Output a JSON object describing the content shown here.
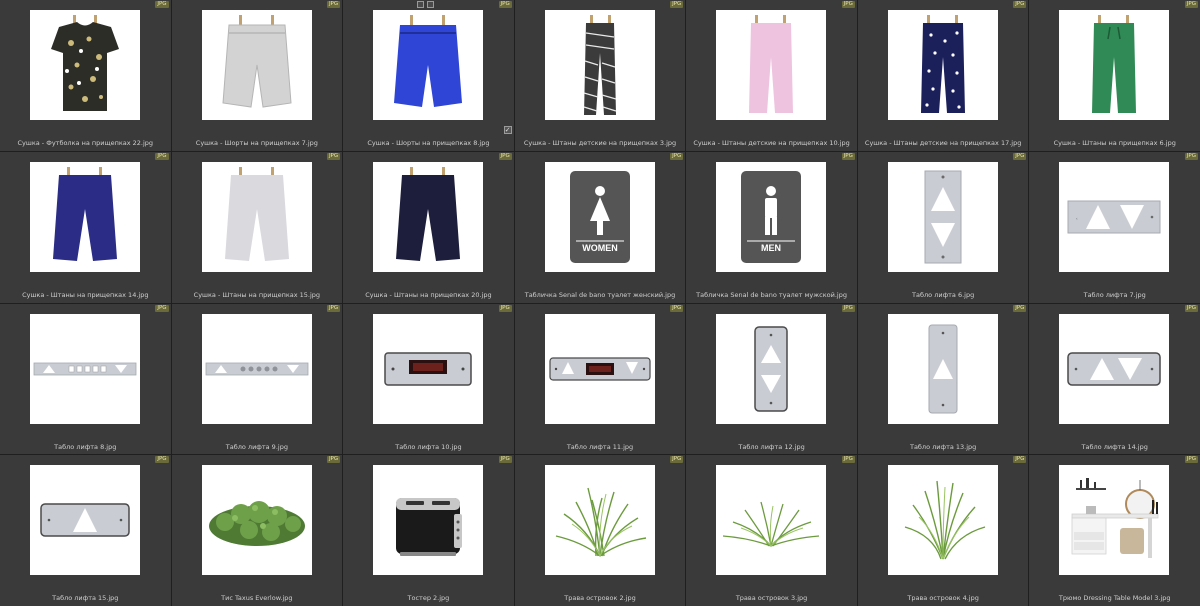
{
  "badge": "JPG",
  "cells": [
    {
      "caption": "Сушка - Футболка на прищепках 22.jpg",
      "icon": "tshirt-icon"
    },
    {
      "caption": "Сушка - Шорты на прищепках 7.jpg",
      "icon": "shorts-icon"
    },
    {
      "caption": "Сушка - Шорты на прищепках 8.jpg",
      "icon": "shorts-icon",
      "selected": true
    },
    {
      "caption": "Сушка - Штаны детские на прищепках 3.jpg",
      "icon": "pants-icon"
    },
    {
      "caption": "Сушка - Штаны детские на прищепках 10.jpg",
      "icon": "pants-icon"
    },
    {
      "caption": "Сушка - Штаны детские на прищепках 17.jpg",
      "icon": "pants-icon"
    },
    {
      "caption": "Сушка - Штаны на прищепках 6.jpg",
      "icon": "pants-icon"
    },
    {
      "caption": "Сушка - Штаны на прищепках 14.jpg",
      "icon": "capri-icon"
    },
    {
      "caption": "Сушка - Штаны на прищепках 15.jpg",
      "icon": "capri-icon"
    },
    {
      "caption": "Сушка - Штаны на прищепках 20.jpg",
      "icon": "capri-icon"
    },
    {
      "caption": "Табличка Senal de bano туалет женский.jpg",
      "icon": "restroom-sign-icon",
      "sign_label": "WOMEN"
    },
    {
      "caption": "Табличка Senal de bano туалет мужской.jpg",
      "icon": "restroom-sign-icon",
      "sign_label": "MEN"
    },
    {
      "caption": "Табло лифта 6.jpg",
      "icon": "elevator-panel-icon"
    },
    {
      "caption": "Табло лифта 7.jpg",
      "icon": "elevator-panel-icon"
    },
    {
      "caption": "Табло лифта 8.jpg",
      "icon": "elevator-panel-icon"
    },
    {
      "caption": "Табло лифта 9.jpg",
      "icon": "elevator-panel-icon"
    },
    {
      "caption": "Табло лифта 10.jpg",
      "icon": "elevator-display-icon"
    },
    {
      "caption": "Табло лифта 11.jpg",
      "icon": "elevator-display-icon"
    },
    {
      "caption": "Табло лифта 12.jpg",
      "icon": "elevator-panel-icon"
    },
    {
      "caption": "Табло лифта 13.jpg",
      "icon": "elevator-panel-icon"
    },
    {
      "caption": "Табло лифта 14.jpg",
      "icon": "elevator-panel-icon"
    },
    {
      "caption": "Табло лифта 15.jpg",
      "icon": "elevator-panel-icon"
    },
    {
      "caption": "Тис Taxus Everlow.jpg",
      "icon": "shrub-icon"
    },
    {
      "caption": "Тостер 2.jpg",
      "icon": "toaster-icon"
    },
    {
      "caption": "Трава островок 2.jpg",
      "icon": "grass-icon"
    },
    {
      "caption": "Трава островок 3.jpg",
      "icon": "grass-icon"
    },
    {
      "caption": "Трава островок 4.jpg",
      "icon": "grass-icon"
    },
    {
      "caption": "Трюмо Dressing Table Model 3.jpg",
      "icon": "dressing-table-icon"
    }
  ]
}
